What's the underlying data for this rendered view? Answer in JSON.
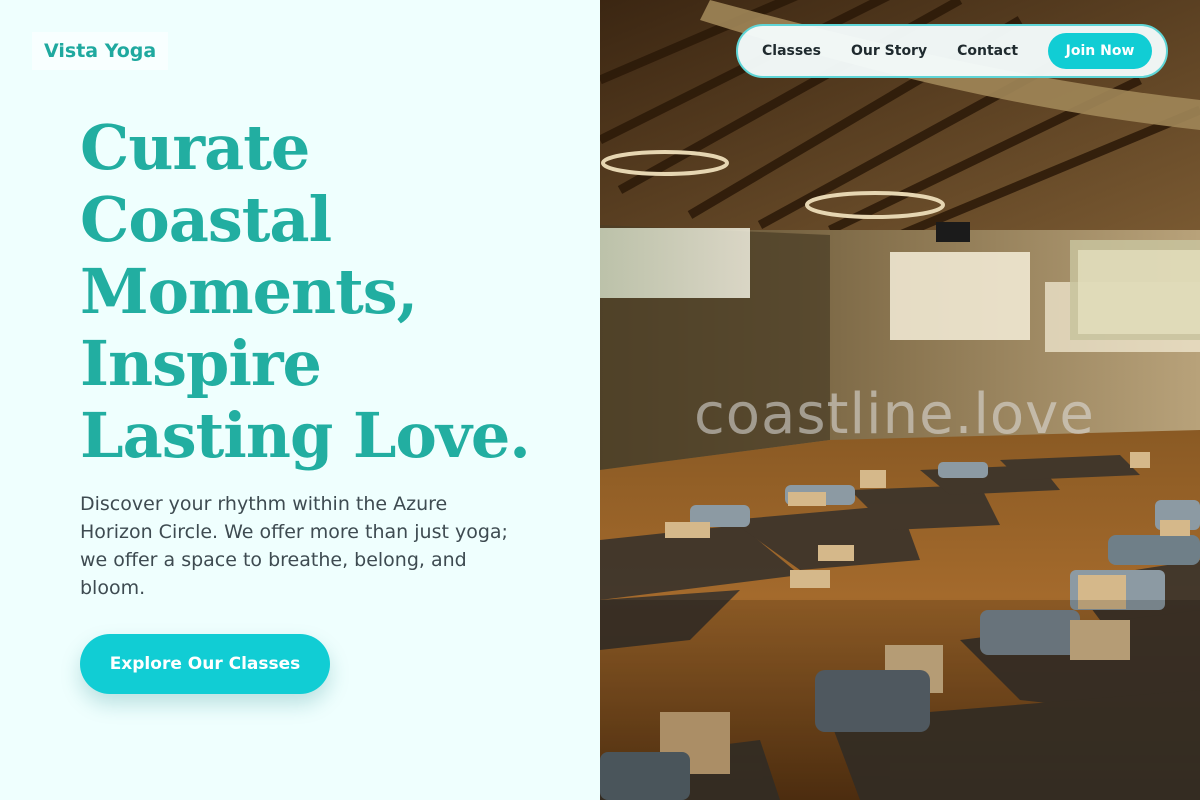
{
  "brand": {
    "name": "Vista Yoga"
  },
  "nav": {
    "links": [
      "Classes",
      "Our Story",
      "Contact"
    ],
    "cta_label": "Join Now"
  },
  "hero": {
    "headline_lines": [
      "Curate",
      "Coastal",
      "Moments,",
      "Inspire",
      "Lasting Love."
    ],
    "intro": "Discover your rhythm within the Azure Horizon Circle. We offer more than just yoga; we offer a space to breathe, belong, and bloom.",
    "cta_label": "Explore Our Classes"
  },
  "image": {
    "subject": "yoga-studio-interior",
    "watermark": "coastline.love"
  },
  "colors": {
    "accent": "#11cdd4",
    "headline": "#22aea1",
    "background": "#effffe",
    "body_text": "#3e4b51"
  }
}
